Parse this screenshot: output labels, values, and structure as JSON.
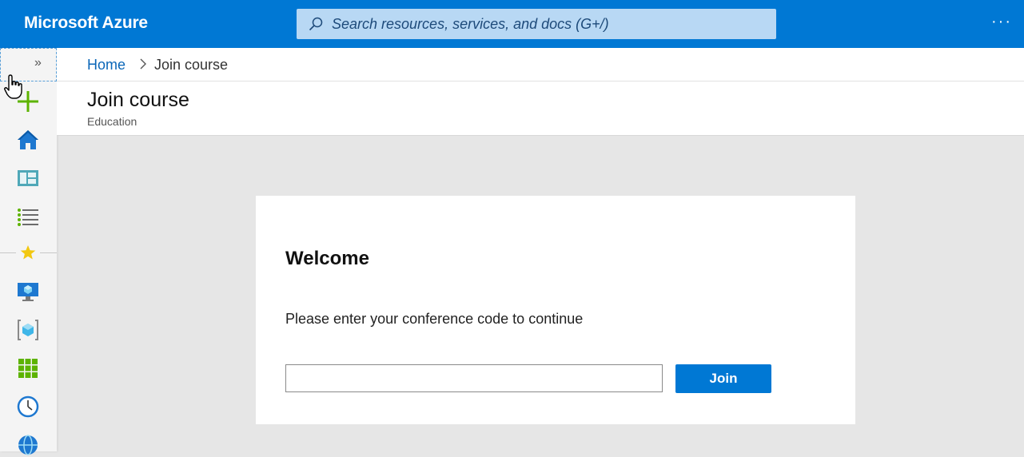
{
  "app": {
    "brand": "Microsoft Azure",
    "more_label": "···"
  },
  "search": {
    "placeholder": "Search resources, services, and docs (G+/)"
  },
  "breadcrumb": {
    "home": "Home",
    "current": "Join course"
  },
  "page": {
    "title": "Join course",
    "subtitle": "Education"
  },
  "card": {
    "heading": "Welcome",
    "prompt": "Please enter your conference code to continue",
    "code_value": "",
    "join_label": "Join"
  },
  "sidebar": {
    "expand_label": "»",
    "items": [
      {
        "icon": "create-resource-icon"
      },
      {
        "icon": "home-icon"
      },
      {
        "icon": "dashboard-icon"
      },
      {
        "icon": "all-services-icon"
      },
      {
        "icon": "favorites-star-icon"
      },
      {
        "icon": "virtual-machines-icon"
      },
      {
        "icon": "resource-groups-icon"
      },
      {
        "icon": "all-resources-icon"
      },
      {
        "icon": "recent-clock-icon"
      },
      {
        "icon": "app-services-icon"
      }
    ]
  },
  "colors": {
    "accent": "#0078d4",
    "link": "#0a66b8",
    "background": "#e6e6e6"
  }
}
